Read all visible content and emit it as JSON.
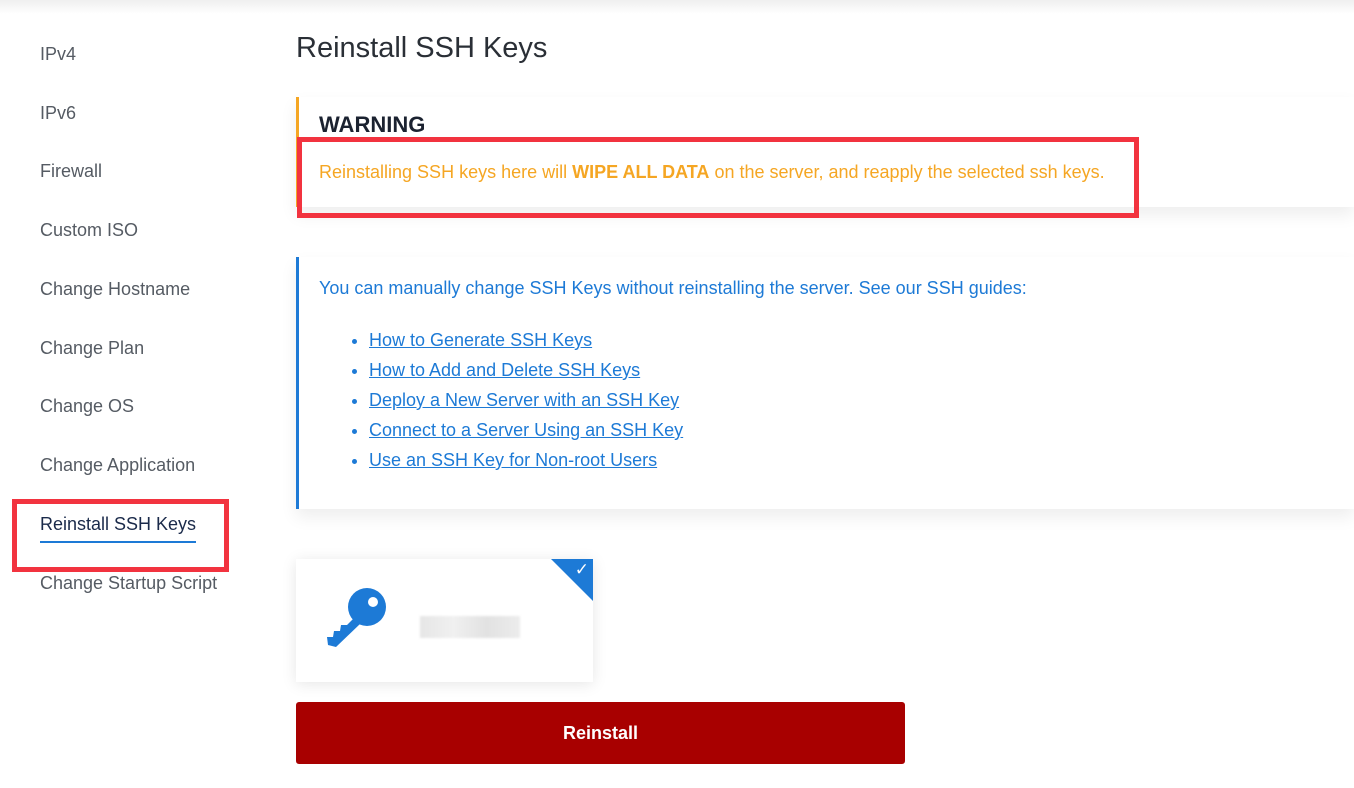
{
  "sidebar": {
    "items": [
      {
        "label": "IPv4"
      },
      {
        "label": "IPv6"
      },
      {
        "label": "Firewall"
      },
      {
        "label": "Custom ISO"
      },
      {
        "label": "Change Hostname"
      },
      {
        "label": "Change Plan"
      },
      {
        "label": "Change OS"
      },
      {
        "label": "Change Application"
      },
      {
        "label": "Reinstall SSH Keys",
        "active": true
      },
      {
        "label": "Change Startup Script"
      }
    ]
  },
  "page": {
    "title": "Reinstall SSH Keys"
  },
  "warning": {
    "title": "WARNING",
    "text_before": "Reinstalling SSH keys here will ",
    "text_bold": "WIPE ALL DATA",
    "text_after": " on the server, and reapply the selected ssh keys."
  },
  "info": {
    "text": "You can manually change SSH Keys without reinstalling the server. See our SSH guides:",
    "guides": [
      {
        "label": "How to Generate SSH Keys"
      },
      {
        "label": "How to Add and Delete SSH Keys"
      },
      {
        "label": "Deploy a New Server with an SSH Key"
      },
      {
        "label": "Connect to a Server Using an SSH Key"
      },
      {
        "label": "Use an SSH Key for Non-root Users"
      }
    ]
  },
  "ssh_key": {
    "icon": "key-icon",
    "selected": true,
    "check_icon": "checkmark-icon"
  },
  "actions": {
    "reinstall_label": "Reinstall"
  },
  "colors": {
    "warning": "#f5a623",
    "link": "#1d7ad6",
    "danger_button": "#a80000",
    "highlight_box": "#f2333f"
  }
}
